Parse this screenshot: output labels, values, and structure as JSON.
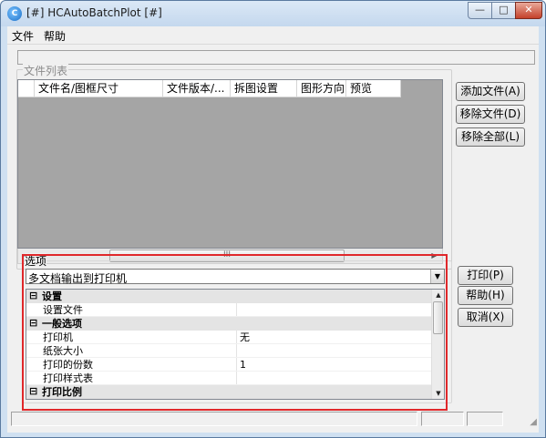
{
  "window": {
    "title": "[#] HCAutoBatchPlot [#]",
    "controls": {
      "minimize": "—",
      "maximize": "□",
      "close": "✕"
    }
  },
  "menu": {
    "file": "文件",
    "help": "帮助"
  },
  "file_list": {
    "legend": "文件列表",
    "columns": [
      "文件名/图框尺寸",
      "文件版本/...",
      "拆图设置",
      "图形方向",
      "预览"
    ],
    "scroll_thumb_label": "III",
    "buttons": {
      "add": "添加文件(A)",
      "remove": "移除文件(D)",
      "remove_all": "移除全部(L)"
    }
  },
  "options": {
    "legend": "选项",
    "mode_selected": "多文档输出到打印机",
    "grid_rows": [
      {
        "type": "category",
        "toggle": "⊟",
        "label": "设置"
      },
      {
        "type": "property",
        "name": "设置文件",
        "value": ""
      },
      {
        "type": "category",
        "toggle": "⊟",
        "label": "一般选项"
      },
      {
        "type": "property",
        "name": "打印机",
        "value": "无"
      },
      {
        "type": "property",
        "name": "纸张大小",
        "value": ""
      },
      {
        "type": "property",
        "name": "打印的份数",
        "value": "1"
      },
      {
        "type": "property",
        "name": "打印样式表",
        "value": ""
      },
      {
        "type": "category",
        "toggle": "⊟",
        "label": "打印比例"
      }
    ]
  },
  "actions": {
    "print": "打印(P)",
    "help": "帮助(H)",
    "cancel": "取消(X)"
  },
  "colors": {
    "highlight": "#e0282b",
    "list_background": "#a5a5a5",
    "category_row": "#e4e4e4"
  }
}
